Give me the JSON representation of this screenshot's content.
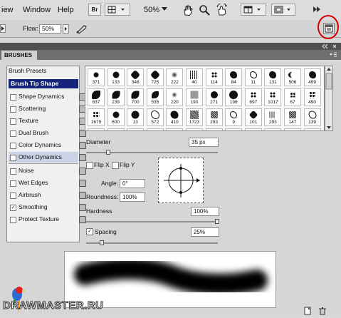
{
  "menubar": {
    "items": [
      "iew",
      "Window",
      "Help"
    ],
    "br_label": "Br",
    "zoom": "50%"
  },
  "options": {
    "flow_label": "Flow:",
    "flow_value": "50%"
  },
  "panel": {
    "title": "BRUSHES"
  },
  "left": {
    "brush_presets": "Brush Presets",
    "tip_shape": "Brush Tip Shape",
    "options": [
      {
        "label": "Shape Dynamics",
        "checked": false
      },
      {
        "label": "Scattering",
        "checked": false
      },
      {
        "label": "Texture",
        "checked": false
      },
      {
        "label": "Dual Brush",
        "checked": false
      },
      {
        "label": "Color Dynamics",
        "checked": false
      },
      {
        "label": "Other Dynamics",
        "checked": false
      },
      {
        "label": "Noise",
        "checked": false
      },
      {
        "label": "Wet Edges",
        "checked": false
      },
      {
        "label": "Airbrush",
        "checked": false
      },
      {
        "label": "Smoothing",
        "checked": true
      },
      {
        "label": "Protect Texture",
        "checked": false
      }
    ]
  },
  "grid": {
    "brushes": [
      "371",
      "133",
      "348",
      "725",
      "222",
      "40",
      "114",
      "84",
      "11",
      "131",
      "506",
      "499",
      "637",
      "239",
      "700",
      "535",
      "220",
      "190",
      "271",
      "198",
      "697",
      "1017",
      "67",
      "490",
      "1679",
      "600",
      "13",
      "572",
      "410",
      "1723",
      "293",
      "9",
      "101",
      "293",
      "147",
      "139",
      "",
      "",
      "",
      "",
      "",
      "",
      "",
      "",
      "",
      "",
      "",
      ""
    ]
  },
  "controls": {
    "diameter_label": "Diameter",
    "diameter_value": "35 px",
    "flip_x": "Flip X",
    "flip_y": "Flip Y",
    "angle_label": "Angle:",
    "angle_value": "0°",
    "roundness_label": "Roundness:",
    "roundness_value": "100%",
    "hardness_label": "Hardness",
    "hardness_value": "100%",
    "spacing_label": "Spacing",
    "spacing_value": "25%",
    "spacing_checked": true
  },
  "watermark": "DRAWMASTER.RU"
}
